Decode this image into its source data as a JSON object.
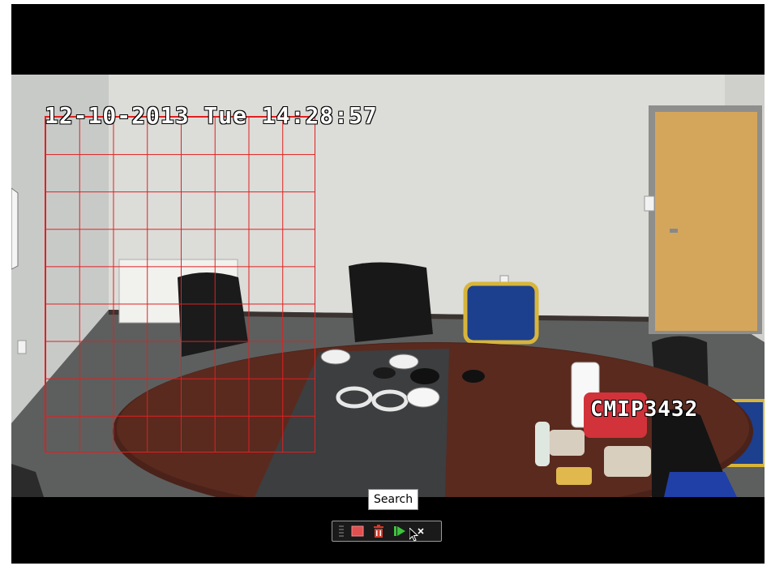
{
  "osd": {
    "datetime": "12-10-2013 Tue 14:28:57",
    "camera_name": "CMIP3432"
  },
  "tooltip": {
    "text": "Search"
  },
  "toolbar": {
    "buttons": [
      {
        "name": "grip",
        "icon": "drag-handle-icon"
      },
      {
        "name": "motion-area-button",
        "icon": "red-square-icon",
        "color": "#e05050"
      },
      {
        "name": "clear-button",
        "icon": "trash-icon",
        "color": "#d63a2a"
      },
      {
        "name": "search-button",
        "icon": "play-icon",
        "color": "#3cc43c"
      },
      {
        "name": "close-button",
        "icon": "close-icon",
        "color": "#ffffff"
      }
    ]
  },
  "colors": {
    "grid": "#e02020",
    "background": "#000000"
  }
}
